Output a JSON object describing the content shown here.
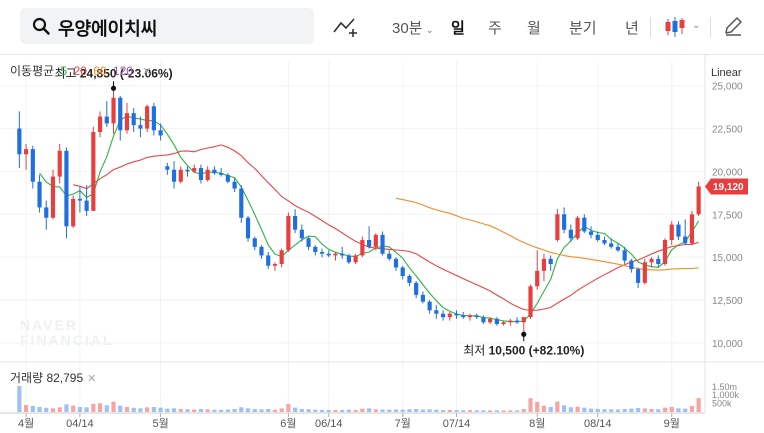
{
  "toolbar": {
    "search_text": "우양에이치씨",
    "interval": "30분",
    "tabs": [
      "일",
      "주",
      "월",
      "분기",
      "년"
    ],
    "active_tab": "일",
    "icons": [
      "search-icon",
      "draw-line-icon",
      "candle-type-icon",
      "pencil-icon"
    ]
  },
  "legend": {
    "ma_label": "이동평균",
    "ma_periods": [
      {
        "label": "5",
        "color": "#2fb344"
      },
      {
        "label": "20",
        "color": "#e84545"
      },
      {
        "label": "60",
        "color": "#f28c28"
      },
      {
        "label": "120",
        "color": "#9b59b6"
      }
    ],
    "scale": "Linear",
    "volume_label": "거래량 82,795"
  },
  "chart_data": {
    "type": "candlestick",
    "up_color": "#e83e3e",
    "down_color": "#1f6fe0",
    "ylim": [
      9000,
      26500
    ],
    "y_ticks": [
      "10,000",
      "12,500",
      "15,000",
      "17,500",
      "20,000",
      "22,500",
      "25,000"
    ],
    "y_tick_values": [
      10000,
      12500,
      15000,
      17500,
      20000,
      22500,
      25000
    ],
    "x_ticks": [
      {
        "label": "4월",
        "index": 1
      },
      {
        "label": "04/14",
        "index": 9
      },
      {
        "label": "5월",
        "index": 21
      },
      {
        "label": "6월",
        "index": 40
      },
      {
        "label": "06/14",
        "index": 46
      },
      {
        "label": "7월",
        "index": 57
      },
      {
        "label": "07/14",
        "index": 65
      },
      {
        "label": "8월",
        "index": 77
      },
      {
        "label": "08/14",
        "index": 86
      },
      {
        "label": "9월",
        "index": 97
      }
    ],
    "candles": [
      [
        22500,
        23500,
        20200,
        21000
      ],
      [
        21000,
        21600,
        20100,
        21300
      ],
      [
        21300,
        21500,
        19000,
        19400
      ],
      [
        19400,
        19800,
        17600,
        17900
      ],
      [
        17900,
        18300,
        16600,
        17300
      ],
      [
        17300,
        20100,
        17200,
        19700
      ],
      [
        19700,
        21600,
        19300,
        21200
      ],
      [
        21200,
        21400,
        16100,
        16800
      ],
      [
        16800,
        18600,
        16700,
        18400
      ],
      [
        18400,
        19100,
        17600,
        18300
      ],
      [
        18300,
        19200,
        17400,
        17700
      ],
      [
        17700,
        22600,
        17700,
        22300
      ],
      [
        22300,
        23500,
        22000,
        23200
      ],
      [
        23200,
        24100,
        22600,
        22800
      ],
      [
        22800,
        24850,
        22200,
        24300
      ],
      [
        24300,
        24400,
        21800,
        22400
      ],
      [
        22400,
        24000,
        22200,
        23400
      ],
      [
        23400,
        23700,
        22300,
        22700
      ],
      [
        22700,
        23200,
        22000,
        22500
      ],
      [
        22500,
        23900,
        22300,
        23800
      ],
      [
        23800,
        24000,
        22100,
        22400
      ],
      [
        22400,
        22800,
        21800,
        22100
      ],
      [
        20300,
        20500,
        19800,
        20100
      ],
      [
        20100,
        20600,
        19000,
        19400
      ],
      [
        19400,
        20300,
        19300,
        20100
      ],
      [
        20100,
        20300,
        19700,
        20000
      ],
      [
        20000,
        20400,
        19900,
        20200
      ],
      [
        20200,
        20400,
        19300,
        19500
      ],
      [
        19500,
        20300,
        19400,
        20100
      ],
      [
        20100,
        20300,
        19800,
        19900
      ],
      [
        19900,
        20200,
        19700,
        19800
      ],
      [
        19800,
        19900,
        19300,
        19400
      ],
      [
        19400,
        19600,
        18800,
        19000
      ],
      [
        19000,
        19200,
        17000,
        17300
      ],
      [
        17300,
        17400,
        15900,
        16100
      ],
      [
        16100,
        16200,
        15400,
        15600
      ],
      [
        15600,
        15700,
        14900,
        15100
      ],
      [
        15100,
        15300,
        14300,
        14500
      ],
      [
        14500,
        14700,
        14200,
        14600
      ],
      [
        14600,
        15500,
        14400,
        15400
      ],
      [
        15400,
        17600,
        15300,
        17400
      ],
      [
        17400,
        17800,
        16400,
        16600
      ],
      [
        16600,
        16900,
        15900,
        16100
      ],
      [
        16100,
        16200,
        15400,
        15600
      ],
      [
        15600,
        15700,
        15100,
        15300
      ],
      [
        15300,
        15500,
        15000,
        15200
      ],
      [
        15200,
        15400,
        15000,
        15100
      ],
      [
        15100,
        15300,
        14800,
        15200
      ],
      [
        15200,
        15600,
        14900,
        15100
      ],
      [
        15100,
        15200,
        14600,
        14700
      ],
      [
        14700,
        15200,
        14600,
        15100
      ],
      [
        15100,
        16200,
        15000,
        16000
      ],
      [
        16000,
        16800,
        15500,
        15600
      ],
      [
        15600,
        16400,
        15400,
        16300
      ],
      [
        16300,
        16500,
        15100,
        15200
      ],
      [
        15200,
        15400,
        14800,
        14900
      ],
      [
        14900,
        15000,
        14200,
        14400
      ],
      [
        14400,
        14500,
        13700,
        13900
      ],
      [
        13900,
        14000,
        13300,
        13500
      ],
      [
        13500,
        13600,
        12600,
        12800
      ],
      [
        12800,
        13000,
        12300,
        12400
      ],
      [
        12400,
        12500,
        11700,
        11900
      ],
      [
        11900,
        12200,
        11400,
        11700
      ],
      [
        11700,
        11900,
        11300,
        11500
      ],
      [
        11500,
        11800,
        11300,
        11700
      ],
      [
        11700,
        11900,
        11400,
        11600
      ],
      [
        11600,
        11800,
        11400,
        11500
      ],
      [
        11500,
        11700,
        11300,
        11600
      ],
      [
        11600,
        11700,
        11400,
        11500
      ],
      [
        11500,
        11600,
        11100,
        11200
      ],
      [
        11200,
        11500,
        11100,
        11400
      ],
      [
        11400,
        11500,
        11000,
        11100
      ],
      [
        11100,
        11300,
        11000,
        11200
      ],
      [
        11200,
        11400,
        11000,
        11300
      ],
      [
        11300,
        11500,
        11100,
        11200
      ],
      [
        11200,
        11400,
        10500,
        11500
      ],
      [
        11500,
        13400,
        11400,
        13300
      ],
      [
        13300,
        15400,
        13100,
        14200
      ],
      [
        14200,
        15200,
        13600,
        14900
      ],
      [
        14900,
        15100,
        14200,
        14600
      ],
      [
        16000,
        17800,
        15900,
        17500
      ],
      [
        17500,
        17900,
        16400,
        16600
      ],
      [
        16600,
        16900,
        15900,
        16100
      ],
      [
        16100,
        17400,
        16000,
        17300
      ],
      [
        17300,
        17500,
        16400,
        16500
      ],
      [
        16500,
        16800,
        16100,
        16300
      ],
      [
        16300,
        16500,
        15900,
        16000
      ],
      [
        16000,
        16200,
        15700,
        15800
      ],
      [
        15800,
        16100,
        15500,
        15600
      ],
      [
        15600,
        15800,
        15300,
        15400
      ],
      [
        15400,
        15600,
        14600,
        14800
      ],
      [
        14800,
        14900,
        14100,
        14300
      ],
      [
        14300,
        14400,
        13200,
        13500
      ],
      [
        13500,
        14900,
        13400,
        14700
      ],
      [
        14700,
        15000,
        14400,
        14900
      ],
      [
        14900,
        15100,
        14400,
        14600
      ],
      [
        14600,
        16100,
        14500,
        16000
      ],
      [
        16000,
        17100,
        15700,
        16900
      ],
      [
        16900,
        17100,
        16000,
        16200
      ],
      [
        16200,
        17200,
        15700,
        15800
      ],
      [
        15800,
        17700,
        15700,
        17500
      ],
      [
        17500,
        19400,
        17400,
        19120
      ]
    ],
    "volumes": [
      155000,
      42000,
      36000,
      30000,
      25000,
      22000,
      28000,
      46000,
      38000,
      30000,
      28000,
      48000,
      52000,
      40000,
      62000,
      38000,
      30000,
      25000,
      22000,
      28000,
      30000,
      26000,
      20000,
      22000,
      18000,
      16000,
      15000,
      18000,
      16000,
      14000,
      13000,
      15000,
      18000,
      28000,
      22000,
      18000,
      16000,
      18000,
      14000,
      22000,
      48000,
      26000,
      18000,
      16000,
      14000,
      13000,
      12000,
      12000,
      13000,
      14000,
      13000,
      20000,
      22000,
      16000,
      15000,
      14000,
      15000,
      14000,
      16000,
      18000,
      15000,
      16000,
      14000,
      12000,
      12000,
      11000,
      10000,
      11000,
      10000,
      10000,
      9000,
      10000,
      9000,
      10000,
      9000,
      18000,
      82000,
      60000,
      38000,
      30000,
      62000,
      40000,
      28000,
      32000,
      26000,
      20000,
      18000,
      17000,
      16000,
      15000,
      18000,
      20000,
      24000,
      22000,
      18000,
      16000,
      26000,
      30000,
      22000,
      20000,
      36000,
      82795
    ],
    "volume_ticks": [
      "1.50m",
      "1,000k",
      "500k"
    ],
    "volume_tick_values": [
      150000,
      100000,
      50000
    ],
    "annotations": [
      {
        "label": "최고",
        "value": "24,850 (-23.06%)",
        "index": 14,
        "price": 24850,
        "pos": "above"
      },
      {
        "label": "최저",
        "value": "10,500 (+82.10%)",
        "index": 75,
        "price": 10500,
        "pos": "below"
      }
    ],
    "last_price": {
      "label": "19,120",
      "value": 19120
    },
    "watermark": [
      "NAVER",
      "FINANCIAL"
    ]
  }
}
